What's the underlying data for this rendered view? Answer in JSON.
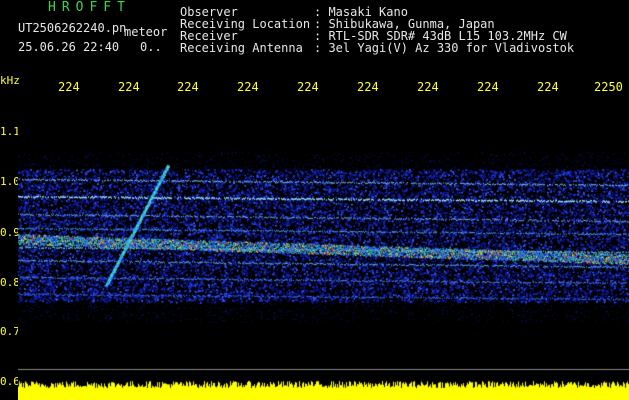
{
  "header": {
    "app_title": "HROFFT",
    "file_name": "UT2506262240.pn",
    "file_tag": "meteor",
    "date_time": "25.06.26 22:40",
    "frac_readout": "0.."
  },
  "station": {
    "observer_label": "Observer",
    "observer_value": ": Masaki Kano",
    "location_label": "Receiving Location",
    "location_value": ": Shibukawa, Gunma, Japan",
    "receiver_label": "Receiver",
    "receiver_value": ": RTL-SDR SDR# 43dB L15 103.2MHz CW",
    "antenna_label": "Receiving Antenna",
    "antenna_value": ": 3el Yagi(V) Az 330 for Vladivostok"
  },
  "axes": {
    "unit": "kHz",
    "time_ticks": [
      "224",
      "224",
      "224",
      "224",
      "224",
      "224",
      "224",
      "224",
      "224",
      "2250"
    ],
    "freq_ticks": [
      "1.1",
      "1.0",
      "0.9",
      "0.8",
      "0.7",
      "0.6"
    ]
  },
  "colors": {
    "title_green": "#3fd24a",
    "axis_yellow": "#ffff33",
    "text_white": "#e6e6e6",
    "background": "#000000",
    "noise_blue": "#1b2fd6",
    "signal_green": "#22c8a0",
    "signal_red": "#e0302a"
  }
}
